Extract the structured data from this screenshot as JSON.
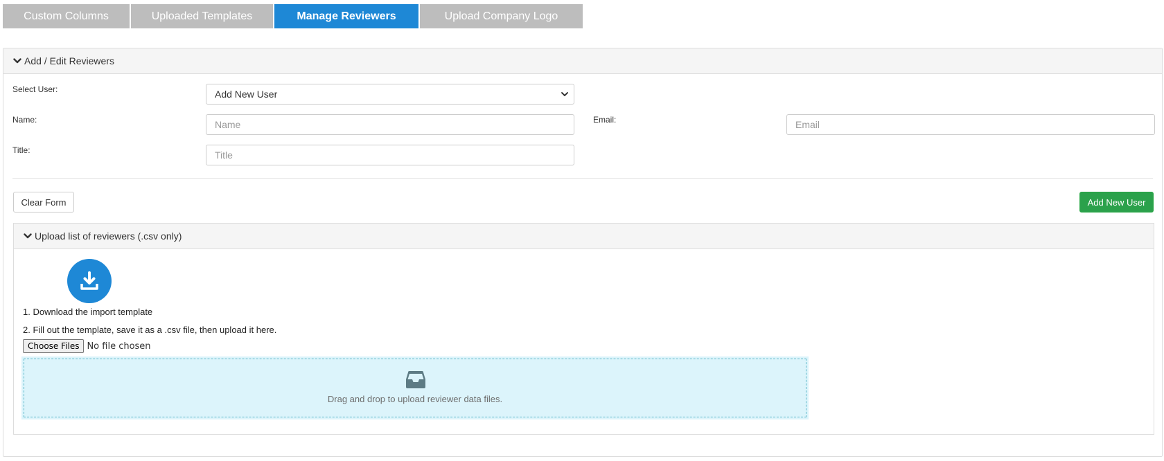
{
  "tabs": [
    {
      "label": "Custom Columns",
      "active": false
    },
    {
      "label": "Uploaded Templates",
      "active": false
    },
    {
      "label": "Manage Reviewers",
      "active": true
    },
    {
      "label": "Upload Company Logo",
      "active": false
    }
  ],
  "reviewers_panel": {
    "heading": "Add / Edit Reviewers",
    "select_user_label": "Select User:",
    "select_user_value": "Add New User",
    "name_label": "Name:",
    "name_placeholder": "Name",
    "email_label": "Email:",
    "email_placeholder": "Email",
    "title_label": "Title:",
    "title_placeholder": "Title",
    "clear_button": "Clear Form",
    "add_button": "Add New User"
  },
  "upload_panel": {
    "heading": "Upload list of reviewers (.csv only)",
    "step1": "1. Download the import template",
    "step2": "2. Fill out the template, save it as a .csv file, then upload it here.",
    "choose_files": "Choose Files",
    "no_file": "No file chosen",
    "dropzone_text": "Drag and drop to upload reviewer data files."
  },
  "colors": {
    "accent": "#1e88d6",
    "success": "#2ba14b",
    "tab_inactive": "#bdbdbd",
    "dropzone_bg": "#dcf4fb"
  },
  "icons": [
    "chevron-down-icon",
    "download-icon",
    "inbox-tray-icon"
  ]
}
